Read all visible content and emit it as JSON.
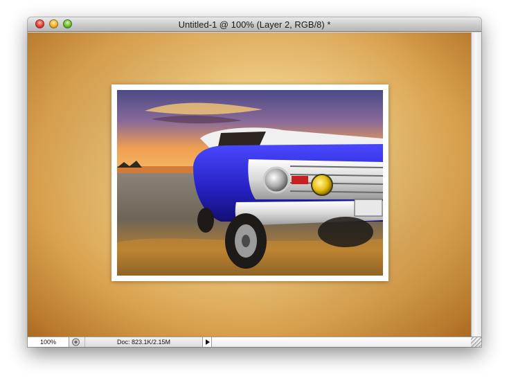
{
  "window": {
    "title": "Untitled-1 @ 100% (Layer 2, RGB/8) *"
  },
  "status_bar": {
    "zoom": "100%",
    "doc_info": "Doc: 823.1K/2.15M"
  },
  "icons": {
    "close": "close-icon",
    "minimize": "minimize-icon",
    "maximize": "maximize-icon",
    "status": "status-icon",
    "menu_arrow": "triangle-right-icon",
    "resize": "resize-grip-icon"
  },
  "colors": {
    "canvas_center": "#f5dea2",
    "canvas_edge": "#a96a22",
    "truck_blue": "#2a28c8",
    "sky_purple": "#6a63a6",
    "sunset_orange": "#f39a3a"
  }
}
